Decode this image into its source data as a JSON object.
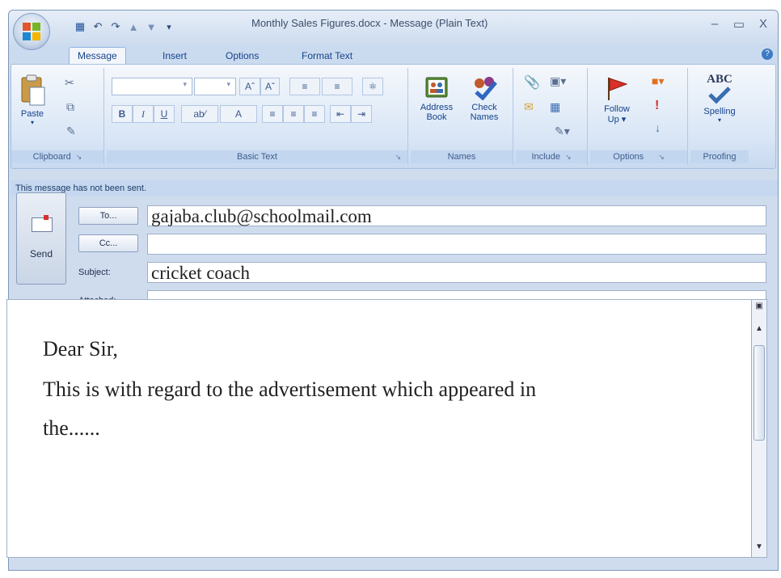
{
  "window": {
    "title": "Monthly Sales Figures.docx - Message (Plain Text)",
    "minimize": "–",
    "maximize": "▭",
    "close": "X"
  },
  "tabs": [
    "Message",
    "Insert",
    "Options",
    "Format Text"
  ],
  "ribbon": {
    "clipboard": {
      "paste": "Paste",
      "label": "Clipboard"
    },
    "basic_text": {
      "label": "Basic Text"
    },
    "names": {
      "address_book": [
        "Address",
        "Book"
      ],
      "check_names": [
        "Check",
        "Names"
      ],
      "label": "Names"
    },
    "include": {
      "label": "Include"
    },
    "options": {
      "follow_up": [
        "Follow",
        "Up"
      ],
      "label": "Options"
    },
    "proofing": {
      "spelling": "Spelling",
      "abc": "ABC",
      "label": "Proofing"
    }
  },
  "infobar": "This message has not been sent.",
  "header": {
    "send_label": "Send",
    "to_label": "To...",
    "cc_label": "Cc...",
    "subject_label": "Subject:",
    "attached_label": "Attached:",
    "to_value": "gajaba.club@schoolmail.com",
    "cc_value": "",
    "subject_value": "cricket coach",
    "attached_value": ""
  },
  "body": {
    "lines": [
      "Dear Sir,",
      "This is with regard to the advertisement which appeared in",
      "the......"
    ]
  },
  "icons": {
    "office": "office-logo",
    "save": "save-icon",
    "undo": "undo-icon",
    "redo": "redo-icon",
    "up": "previous-item-icon",
    "down": "next-item-icon"
  },
  "colors": {
    "ribbon_blue": "#15428b",
    "flag_red": "#d9302a"
  }
}
